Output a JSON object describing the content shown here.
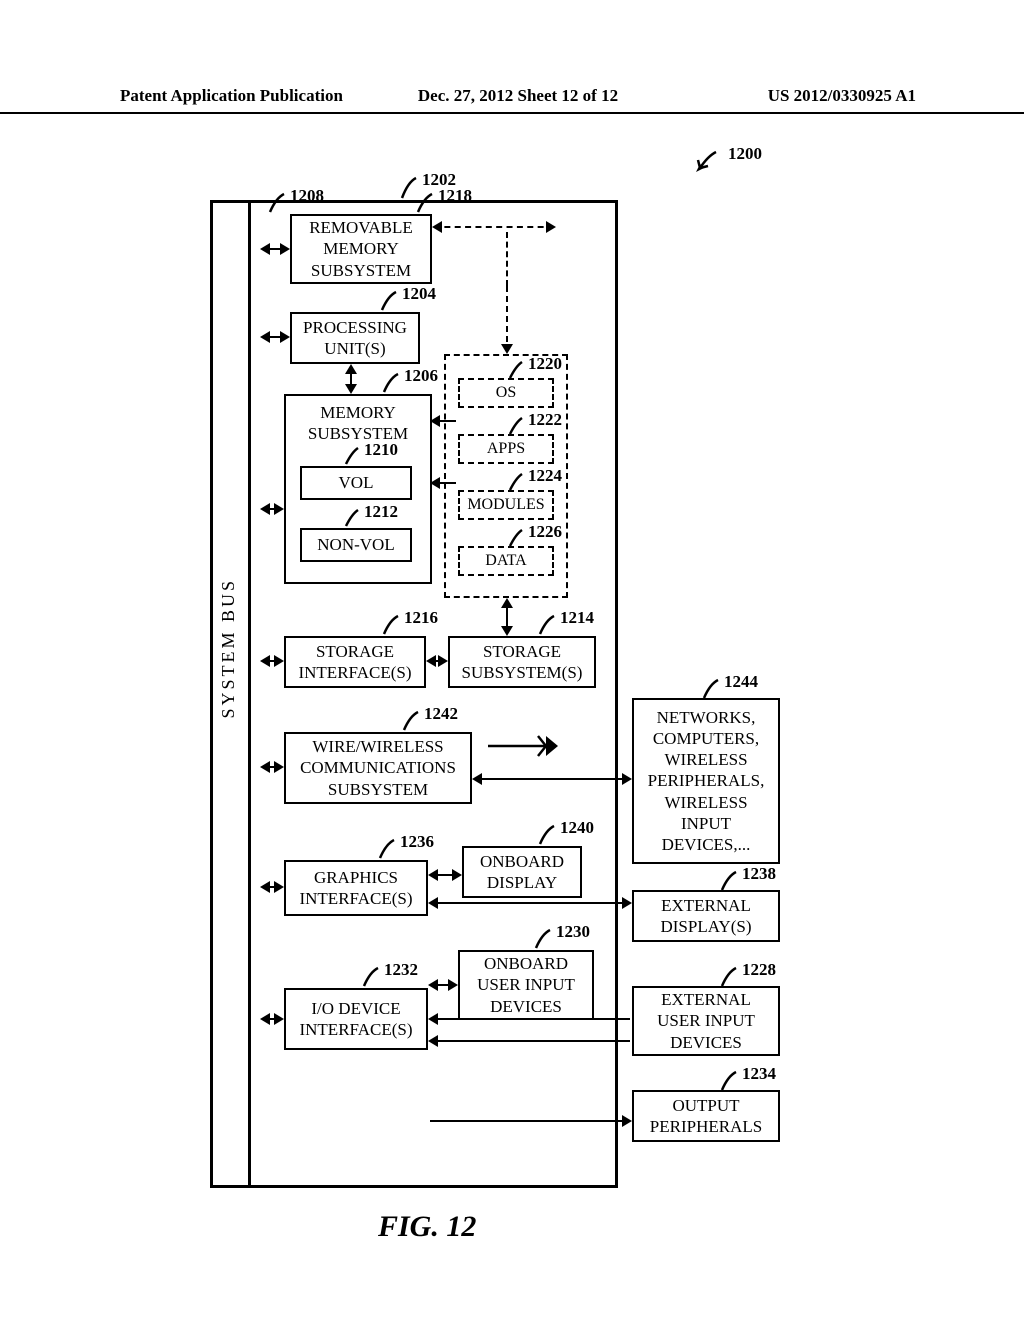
{
  "header": {
    "left": "Patent Application Publication",
    "center": "Dec. 27, 2012  Sheet 12 of 12",
    "right": "US 2012/0330925 A1"
  },
  "figure": {
    "caption": "FIG. 12",
    "overall_ref": "1200",
    "computer_ref": "1202",
    "bus_label": "SYSTEM  BUS"
  },
  "blocks": {
    "removable_mem": {
      "ref": "1208",
      "label": "REMOVABLE\nMEMORY\nSUBSYSTEM"
    },
    "proc_units": {
      "ref": "1204",
      "label": "PROCESSING\nUNIT(S)"
    },
    "mem_subsystem": {
      "ref": "1206",
      "label": "MEMORY\nSUBSYSTEM"
    },
    "vol": {
      "ref": "1210",
      "label": "VOL"
    },
    "nonvol": {
      "ref": "1212",
      "label": "NON-VOL"
    },
    "storage_if": {
      "ref": "1216",
      "label": "STORAGE\nINTERFACE(S)"
    },
    "storage_sub": {
      "ref": "1214",
      "label": "STORAGE\nSUBSYSTEM(S)"
    },
    "comm": {
      "ref": "1242",
      "label": "WIRE/WIRELESS\nCOMMUNICATIONS\nSUBSYSTEM"
    },
    "graphics": {
      "ref": "1236",
      "label": "GRAPHICS\nINTERFACE(S)"
    },
    "onboard_disp": {
      "ref": "1240",
      "label": "ONBOARD\nDISPLAY"
    },
    "io_if": {
      "ref": "1232",
      "label": "I/O DEVICE\nINTERFACE(S)"
    },
    "onboard_input": {
      "ref": "1230",
      "label": "ONBOARD\nUSER INPUT\nDEVICES"
    },
    "networks": {
      "ref": "1244",
      "label": "NETWORKS,\nCOMPUTERS,\nWIRELESS\nPERIPHERALS,\nWIRELESS\nINPUT\nDEVICES,..."
    },
    "ext_disp": {
      "ref": "1238",
      "label": "EXTERNAL\nDISPLAY(S)"
    },
    "ext_input": {
      "ref": "1228",
      "label": "EXTERNAL\nUSER INPUT\nDEVICES"
    },
    "out_periph": {
      "ref": "1234",
      "label": "OUTPUT\nPERIPHERALS"
    },
    "dashed_outer": {
      "ref": "1218"
    },
    "os": {
      "ref": "1220",
      "label": "OS"
    },
    "apps": {
      "ref": "1222",
      "label": "APPS"
    },
    "modules": {
      "ref": "1224",
      "label": "MODULES"
    },
    "data": {
      "ref": "1226",
      "label": "DATA"
    }
  }
}
